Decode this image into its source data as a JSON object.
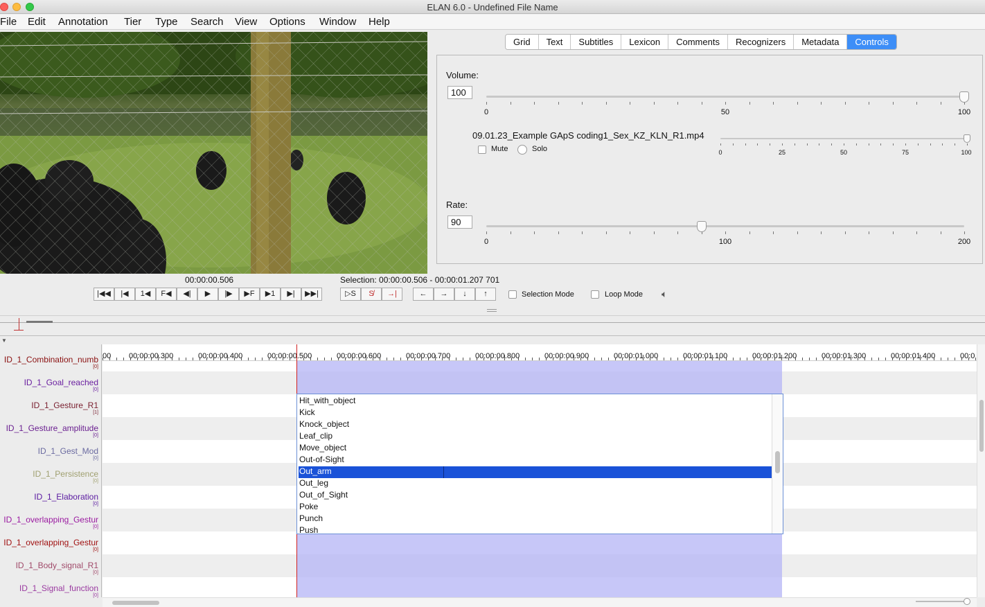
{
  "window": {
    "title": "ELAN 6.0 - Undefined File Name"
  },
  "menu": [
    "File",
    "Edit",
    "Annotation",
    "Tier",
    "Type",
    "Search",
    "View",
    "Options",
    "Window",
    "Help"
  ],
  "tabs": [
    {
      "label": "Grid",
      "active": false
    },
    {
      "label": "Text",
      "active": false
    },
    {
      "label": "Subtitles",
      "active": false
    },
    {
      "label": "Lexicon",
      "active": false
    },
    {
      "label": "Comments",
      "active": false
    },
    {
      "label": "Recognizers",
      "active": false
    },
    {
      "label": "Metadata",
      "active": false
    },
    {
      "label": "Controls",
      "active": true
    }
  ],
  "controls": {
    "volume_label": "Volume:",
    "volume_value": "100",
    "volume_ticks": [
      "0",
      "50",
      "100"
    ],
    "volume_level": 1.0,
    "media_file": "09.01.23_Example GApS coding1_Sex_KZ_KLN_R1.mp4",
    "mute_label": "Mute",
    "solo_label": "Solo",
    "media_ticks": [
      "0",
      "25",
      "50",
      "75",
      "100"
    ],
    "media_level": 1.0,
    "rate_label": "Rate:",
    "rate_value": "90",
    "rate_ticks": [
      "0",
      "100",
      "200"
    ],
    "rate_level": 0.45
  },
  "transport": {
    "current_time": "00:00:00.506",
    "selection": "Selection: 00:00:00.506 - 00:00:01.207  701",
    "selection_mode_label": "Selection Mode",
    "loop_mode_label": "Loop Mode"
  },
  "ruler": {
    "labels": [
      "00",
      "00:00:00.300",
      "00:00:00.400",
      "00:00:00.500",
      "00:00:00.600",
      "00:00:00.700",
      "00:00:00.800",
      "00:00:00.900",
      "00:00:01.000",
      "00:00:01.100",
      "00:00:01.200",
      "00:00:01.300",
      "00:00:01.400",
      "00:0"
    ]
  },
  "tiers": [
    {
      "name": "ID_1_Combination_numb",
      "count": "[0]",
      "color": "#8a1010"
    },
    {
      "name": "ID_1_Goal_reached",
      "count": "[0]",
      "color": "#6a1fa0"
    },
    {
      "name": "ID_1_Gesture_R1",
      "count": "[1]",
      "color": "#7a2030"
    },
    {
      "name": "ID_1_Gesture_amplitude",
      "count": "[0]",
      "color": "#6a1f90"
    },
    {
      "name": "ID_1_Gest_Mod",
      "count": "[0]",
      "color": "#6a6aa0"
    },
    {
      "name": "ID_1_Persistence",
      "count": "[0]",
      "color": "#a0a070"
    },
    {
      "name": "ID_1_Elaboration",
      "count": "[0]",
      "color": "#5a1aa0"
    },
    {
      "name": "ID_1_overlapping_Gestur",
      "count": "[0]",
      "color": "#9a1aa0"
    },
    {
      "name": "ID_1_overlapping_Gestur",
      "count": "[0]",
      "color": "#a01010"
    },
    {
      "name": "ID_1_Body_signal_R1",
      "count": "[0]",
      "color": "#a04a6a"
    },
    {
      "name": "ID_1_Signal_function",
      "count": "[0]",
      "color": "#9a3aa0"
    }
  ],
  "dropdown": {
    "items": [
      "Hit_with_object",
      "Kick",
      "Knock_object",
      "Leaf_clip",
      "Move_object",
      "Out-of-Sight",
      "Out_arm",
      "Out_leg",
      "Out_of_Sight",
      "Poke",
      "Punch",
      "Push"
    ],
    "selected": "Out_arm"
  }
}
